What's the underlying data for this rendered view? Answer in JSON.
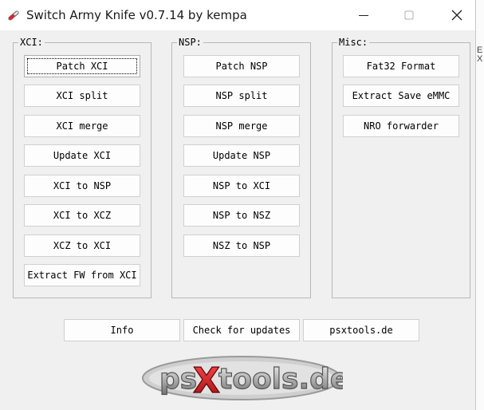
{
  "window": {
    "title": "Switch Army Knife v0.7.14 by kempa"
  },
  "xci": {
    "legend": "XCI:",
    "buttons": [
      "Patch XCI",
      "XCI split",
      "XCI merge",
      "Update XCI",
      "XCI to NSP",
      "XCI to XCZ",
      "XCZ to XCI",
      "Extract FW from XCI"
    ]
  },
  "nsp": {
    "legend": "NSP:",
    "buttons": [
      "Patch NSP",
      "NSP split",
      "NSP merge",
      "Update NSP",
      "NSP to XCI",
      "NSP to NSZ",
      "NSZ to NSP"
    ]
  },
  "misc": {
    "legend": "Misc:",
    "buttons": [
      "Fat32 Format",
      "Extract Save eMMC",
      "NRO forwarder"
    ]
  },
  "footer": {
    "info": "Info",
    "check_updates": "Check for updates",
    "site": "psxtools.de"
  },
  "logo": {
    "text": "psXtools.de"
  },
  "colors": {
    "window_bg": "#f0f0f0",
    "titlebar_bg": "#ffffff",
    "logo_red": "#c8181e"
  }
}
